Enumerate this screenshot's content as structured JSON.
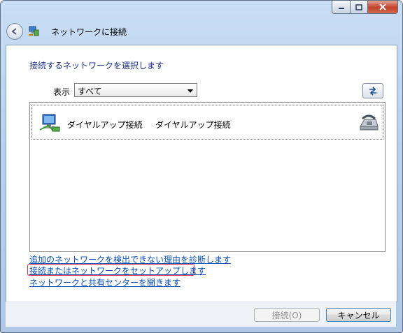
{
  "window": {
    "title": "ネットワークに接続",
    "controls": {
      "minimize": "",
      "maximize": "",
      "close": ""
    }
  },
  "heading": "接続するネットワークを選択します",
  "filter": {
    "label": "表示",
    "selected": "すべて"
  },
  "networks": [
    {
      "name": "ダイヤルアップ接続",
      "type": "ダイヤルアップ接続"
    }
  ],
  "links": [
    "追加のネットワークを検出できない理由を診断します",
    "接続またはネットワークをセットアップします",
    "ネットワークと共有センターを開きます"
  ],
  "buttons": {
    "connect": "接続(O)",
    "cancel": "キャンセル"
  },
  "icons": {
    "back": "back-arrow-icon",
    "title": "network-connect-icon",
    "refresh": "refresh-icon",
    "dialup": "dialup-computer-icon",
    "modem": "phone-modem-icon"
  },
  "colors": {
    "heading": "#1e3287",
    "link": "#0b4fb3",
    "focus": "#e0324a"
  }
}
